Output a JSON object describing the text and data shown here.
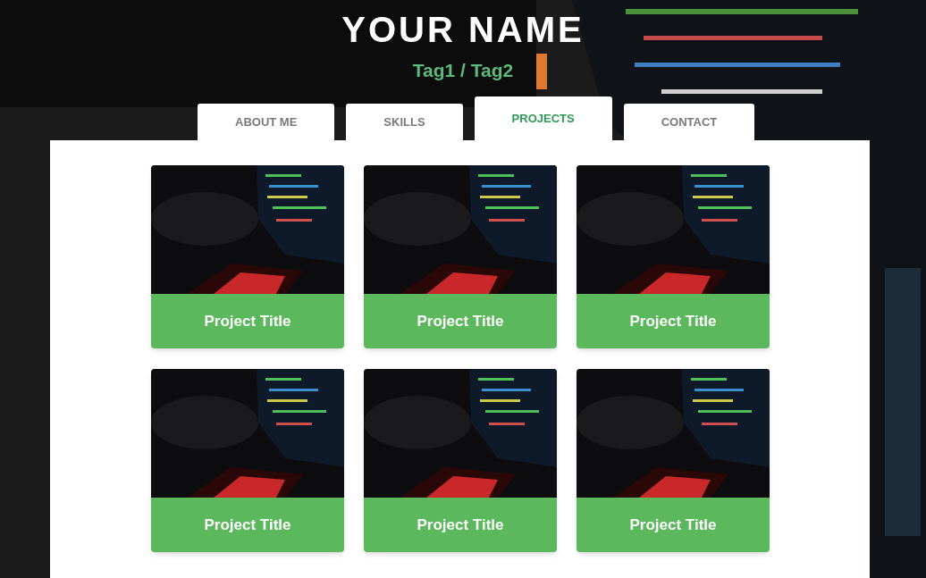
{
  "header": {
    "title": "YOUR NAME",
    "tagline": "Tag1 / Tag2"
  },
  "tabs": [
    {
      "label": "ABOUT ME",
      "selected": false
    },
    {
      "label": "SKILLS",
      "selected": false
    },
    {
      "label": "PROJECTS",
      "selected": true
    },
    {
      "label": "CONTACT",
      "selected": false
    }
  ],
  "projects": [
    {
      "title": "Project Title",
      "kind": "picture"
    },
    {
      "title": "Project Title",
      "kind": "picture"
    },
    {
      "title": "Project Title",
      "kind": "picture"
    },
    {
      "title": "Project Title",
      "kind": "picture"
    },
    {
      "title": "Project Title",
      "kind": "picture"
    },
    {
      "title": "Project Title",
      "kind": "picture"
    }
  ]
}
